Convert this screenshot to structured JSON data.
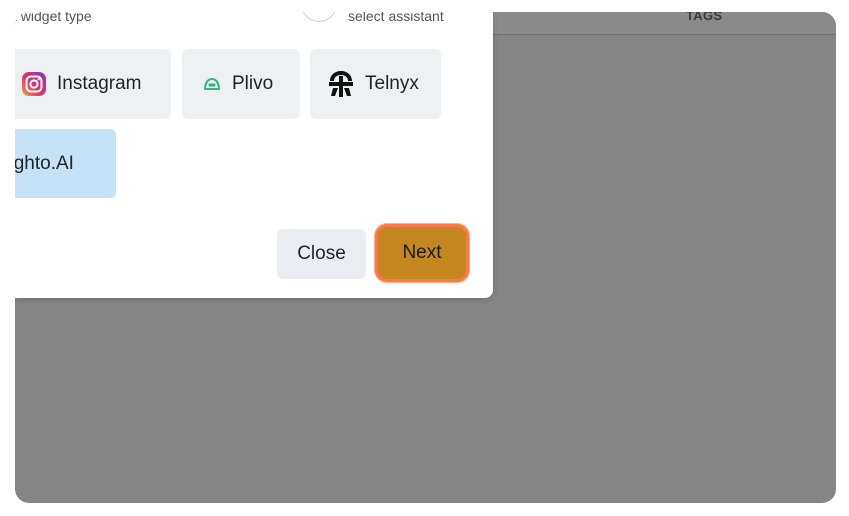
{
  "modal": {
    "widget_type_label": "t widget type",
    "assistant_label": "select assistant",
    "options": [
      {
        "label": "Instagram",
        "icon": "instagram-icon"
      },
      {
        "label": "Plivo",
        "icon": "plivo-icon"
      },
      {
        "label": "Telnyx",
        "icon": "telnyx-icon"
      },
      {
        "label": "sighto.AI",
        "icon": ""
      }
    ],
    "close_label": "Close",
    "next_label": "Next"
  },
  "table": {
    "tags_header": "TAGS"
  },
  "colors": {
    "overlay": "#858585",
    "selected_option": "#c5e3f6",
    "next_button": "#c4861e",
    "highlight_border": "#ff7847",
    "plivo_green": "#2fb67a"
  }
}
